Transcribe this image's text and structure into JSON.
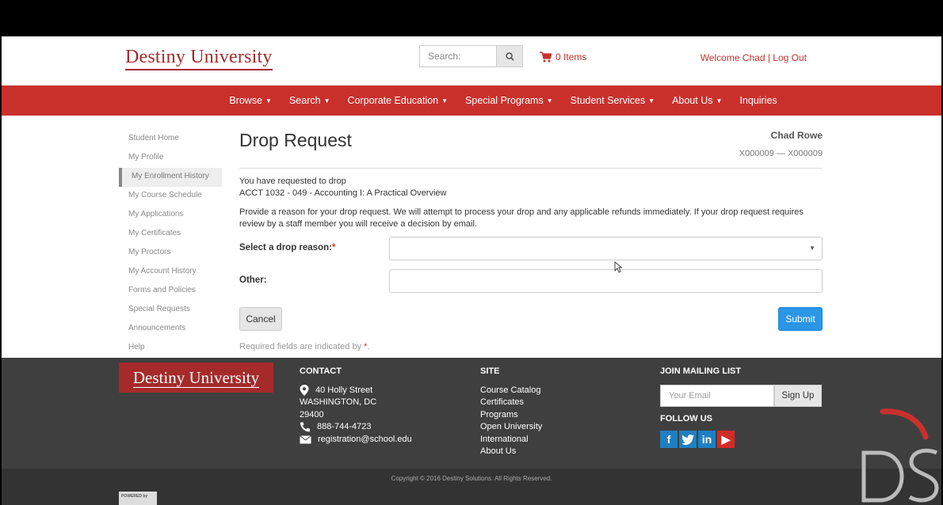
{
  "header": {
    "logo": "Destiny University",
    "search_placeholder": "Search:",
    "cart_label": "0 Items",
    "welcome": "Welcome Chad | Log Out"
  },
  "nav": {
    "items": [
      "Browse",
      "Search",
      "Corporate Education",
      "Special Programs",
      "Student Services",
      "About Us",
      "Inquiries"
    ],
    "caret": "▼"
  },
  "sidebar": {
    "items": [
      {
        "label": "Student Home"
      },
      {
        "label": "My Profile"
      },
      {
        "label": "My Enrollment History",
        "active": true
      },
      {
        "label": "My Course Schedule"
      },
      {
        "label": "My Applications"
      },
      {
        "label": "My Certificates"
      },
      {
        "label": "My Proctors"
      },
      {
        "label": "My Account History"
      },
      {
        "label": "Forms and Policies"
      },
      {
        "label": "Special Requests"
      },
      {
        "label": "Announcements"
      },
      {
        "label": "Help"
      }
    ]
  },
  "main": {
    "title": "Drop Request",
    "student_name": "Chad Rowe",
    "student_id": "X000009 — X000009",
    "drop_intro": "You have requested to drop",
    "course": "ACCT 1032 - 049 - Accounting I: A Practical Overview",
    "provide_text": "Provide a reason for your drop request. We will attempt to process your drop and any applicable refunds immediately. If your drop request requires review by a staff member you will receive a decision by email.",
    "select_label": "Select a drop reason:",
    "required_marker": "*",
    "select_value": "",
    "other_label": "Other:",
    "other_value": "",
    "cancel": "Cancel",
    "submit": "Submit",
    "required_note": "Required fields are indicated by",
    "required_note_end": "."
  },
  "footer": {
    "logo": "Destiny University",
    "contact": {
      "heading": "CONTACT",
      "street": "40 Holly Street",
      "city": "WASHINGTON, DC",
      "zip": "29400",
      "phone": "888-744-4723",
      "email": "registration@school.edu"
    },
    "site": {
      "heading": "SITE",
      "links": [
        "Course Catalog",
        "Certificates",
        "Programs",
        "Open University",
        "International",
        "About Us"
      ]
    },
    "mailing": {
      "heading": "JOIN MAILING LIST",
      "placeholder": "Your Email",
      "button": "Sign Up",
      "follow": "FOLLOW US",
      "social": [
        "f",
        "t",
        "in",
        "▶"
      ]
    },
    "copyright": "Copyright © 2016 Destiny Solutions. All Rights Reserved.",
    "powered": "POWERED by"
  },
  "colors": {
    "brand_red": "#c9302c",
    "logo_red": "#a52a2a",
    "submit_blue": "#2a96e6",
    "footer_bg": "#3f3f3f"
  }
}
